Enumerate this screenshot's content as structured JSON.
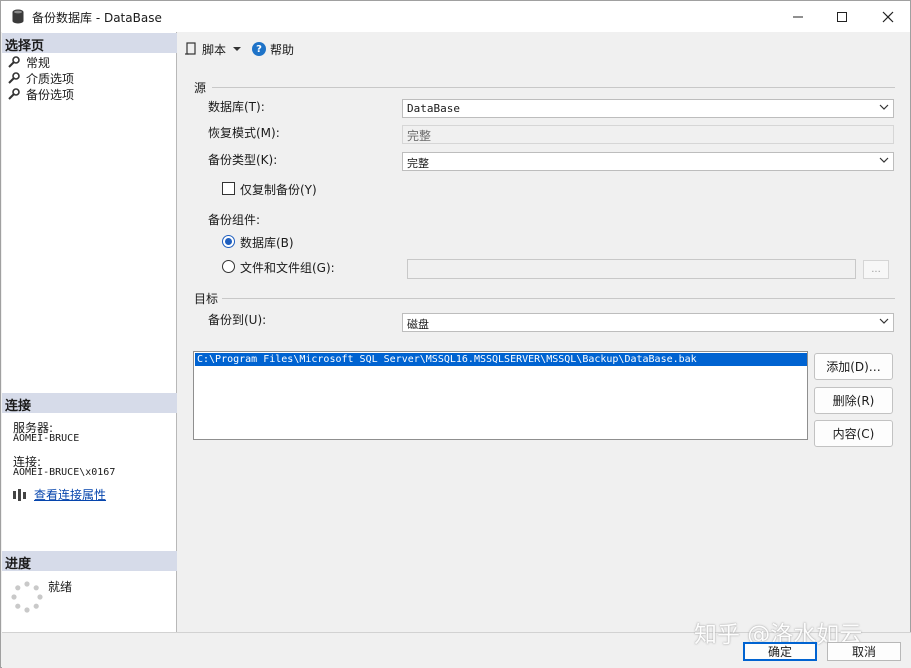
{
  "window": {
    "title": "备份数据库 - DataBase"
  },
  "left": {
    "select_page_header": "选择页",
    "nav_items": [
      "常规",
      "介质选项",
      "备份选项"
    ],
    "connection_header": "连接",
    "server_label": "服务器:",
    "server_value": "AOMEI-BRUCE",
    "connection_label": "连接:",
    "connection_value": "AOMEI-BRUCE\\x0167",
    "view_props_link": "查看连接属性",
    "progress_header": "进度",
    "progress_status": "就绪"
  },
  "toolbar": {
    "script_label": "脚本",
    "help_label": "帮助"
  },
  "source": {
    "group_title": "源",
    "database_label": "数据库(T):",
    "database_value": "DataBase",
    "recovery_label": "恢复模式(M):",
    "recovery_value": "完整",
    "backup_type_label": "备份类型(K):",
    "backup_type_value": "完整",
    "copy_only_label": "仅复制备份(Y)",
    "copy_only_checked": false,
    "component_label": "备份组件:",
    "component_database": "数据库(B)",
    "component_files": "文件和文件组(G):",
    "component_selected": "database"
  },
  "destination": {
    "group_title": "目标",
    "backup_to_label": "备份到(U):",
    "backup_to_value": "磁盘",
    "paths": [
      "C:\\Program Files\\Microsoft SQL Server\\MSSQL16.MSSQLSERVER\\MSSQL\\Backup\\DataBase.bak"
    ],
    "add_button": "添加(D)…",
    "remove_button": "删除(R)",
    "contents_button": "内容(C)"
  },
  "footer": {
    "ok_button": "确定",
    "cancel_button": "取消"
  },
  "watermark": "知乎 @洛水如云",
  "colors": {
    "accent": "#0063d1",
    "header_bg": "#d6dbe9",
    "link": "#0645ad"
  }
}
